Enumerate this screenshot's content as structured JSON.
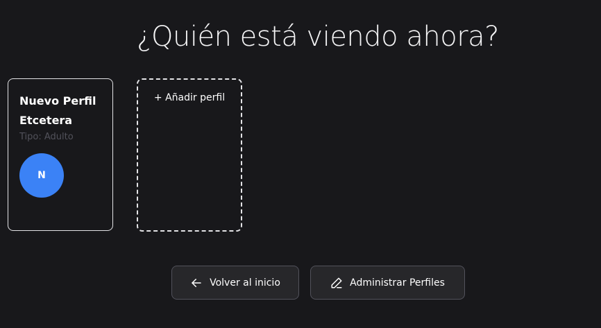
{
  "header": {
    "title": "¿Quién está viendo ahora?"
  },
  "profiles": [
    {
      "name": "Nuevo Perfil Etcetera",
      "type": "Tipo: Adulto",
      "initial": "N",
      "avatar_color": "#3b82f6"
    }
  ],
  "add_profile": {
    "label": "+ Añadir perfil"
  },
  "actions": {
    "back_label": "Volver al inicio",
    "back_icon": "arrow-left-icon",
    "manage_label": "Administrar Perfiles",
    "manage_icon": "pencil-icon"
  },
  "colors": {
    "background": "#18181b",
    "button_background": "#27272a",
    "accent": "#3b82f6"
  }
}
